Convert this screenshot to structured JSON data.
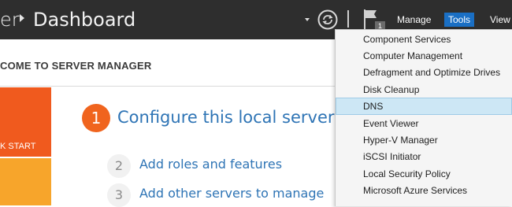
{
  "header": {
    "breadcrumb_parent_tail": "er",
    "page_title": "Dashboard",
    "notification_count": "1",
    "menus": {
      "manage": "Manage",
      "tools": "Tools",
      "view": "View"
    }
  },
  "welcome": {
    "title": "COME TO SERVER MANAGER",
    "quick_start_label": "K START"
  },
  "steps": [
    {
      "number": "1",
      "label": "Configure this local server"
    },
    {
      "number": "2",
      "label": "Add roles and features"
    },
    {
      "number": "3",
      "label": "Add other servers to manage"
    }
  ],
  "tools_menu": {
    "items": [
      "Component Services",
      "Computer Management",
      "Defragment and Optimize Drives",
      "Disk Cleanup",
      "DNS",
      "Event Viewer",
      "Hyper-V Manager",
      "iSCSI Initiator",
      "Local Security Policy",
      "Microsoft Azure Services"
    ],
    "selected": "DNS"
  },
  "colors": {
    "header_bg": "#2e2e2e",
    "accent_blue": "#1a6fc4",
    "orange": "#f05a1e",
    "amber": "#f7a52b",
    "link_blue": "#2e74b5",
    "menu_highlight": "#cde7f5"
  }
}
